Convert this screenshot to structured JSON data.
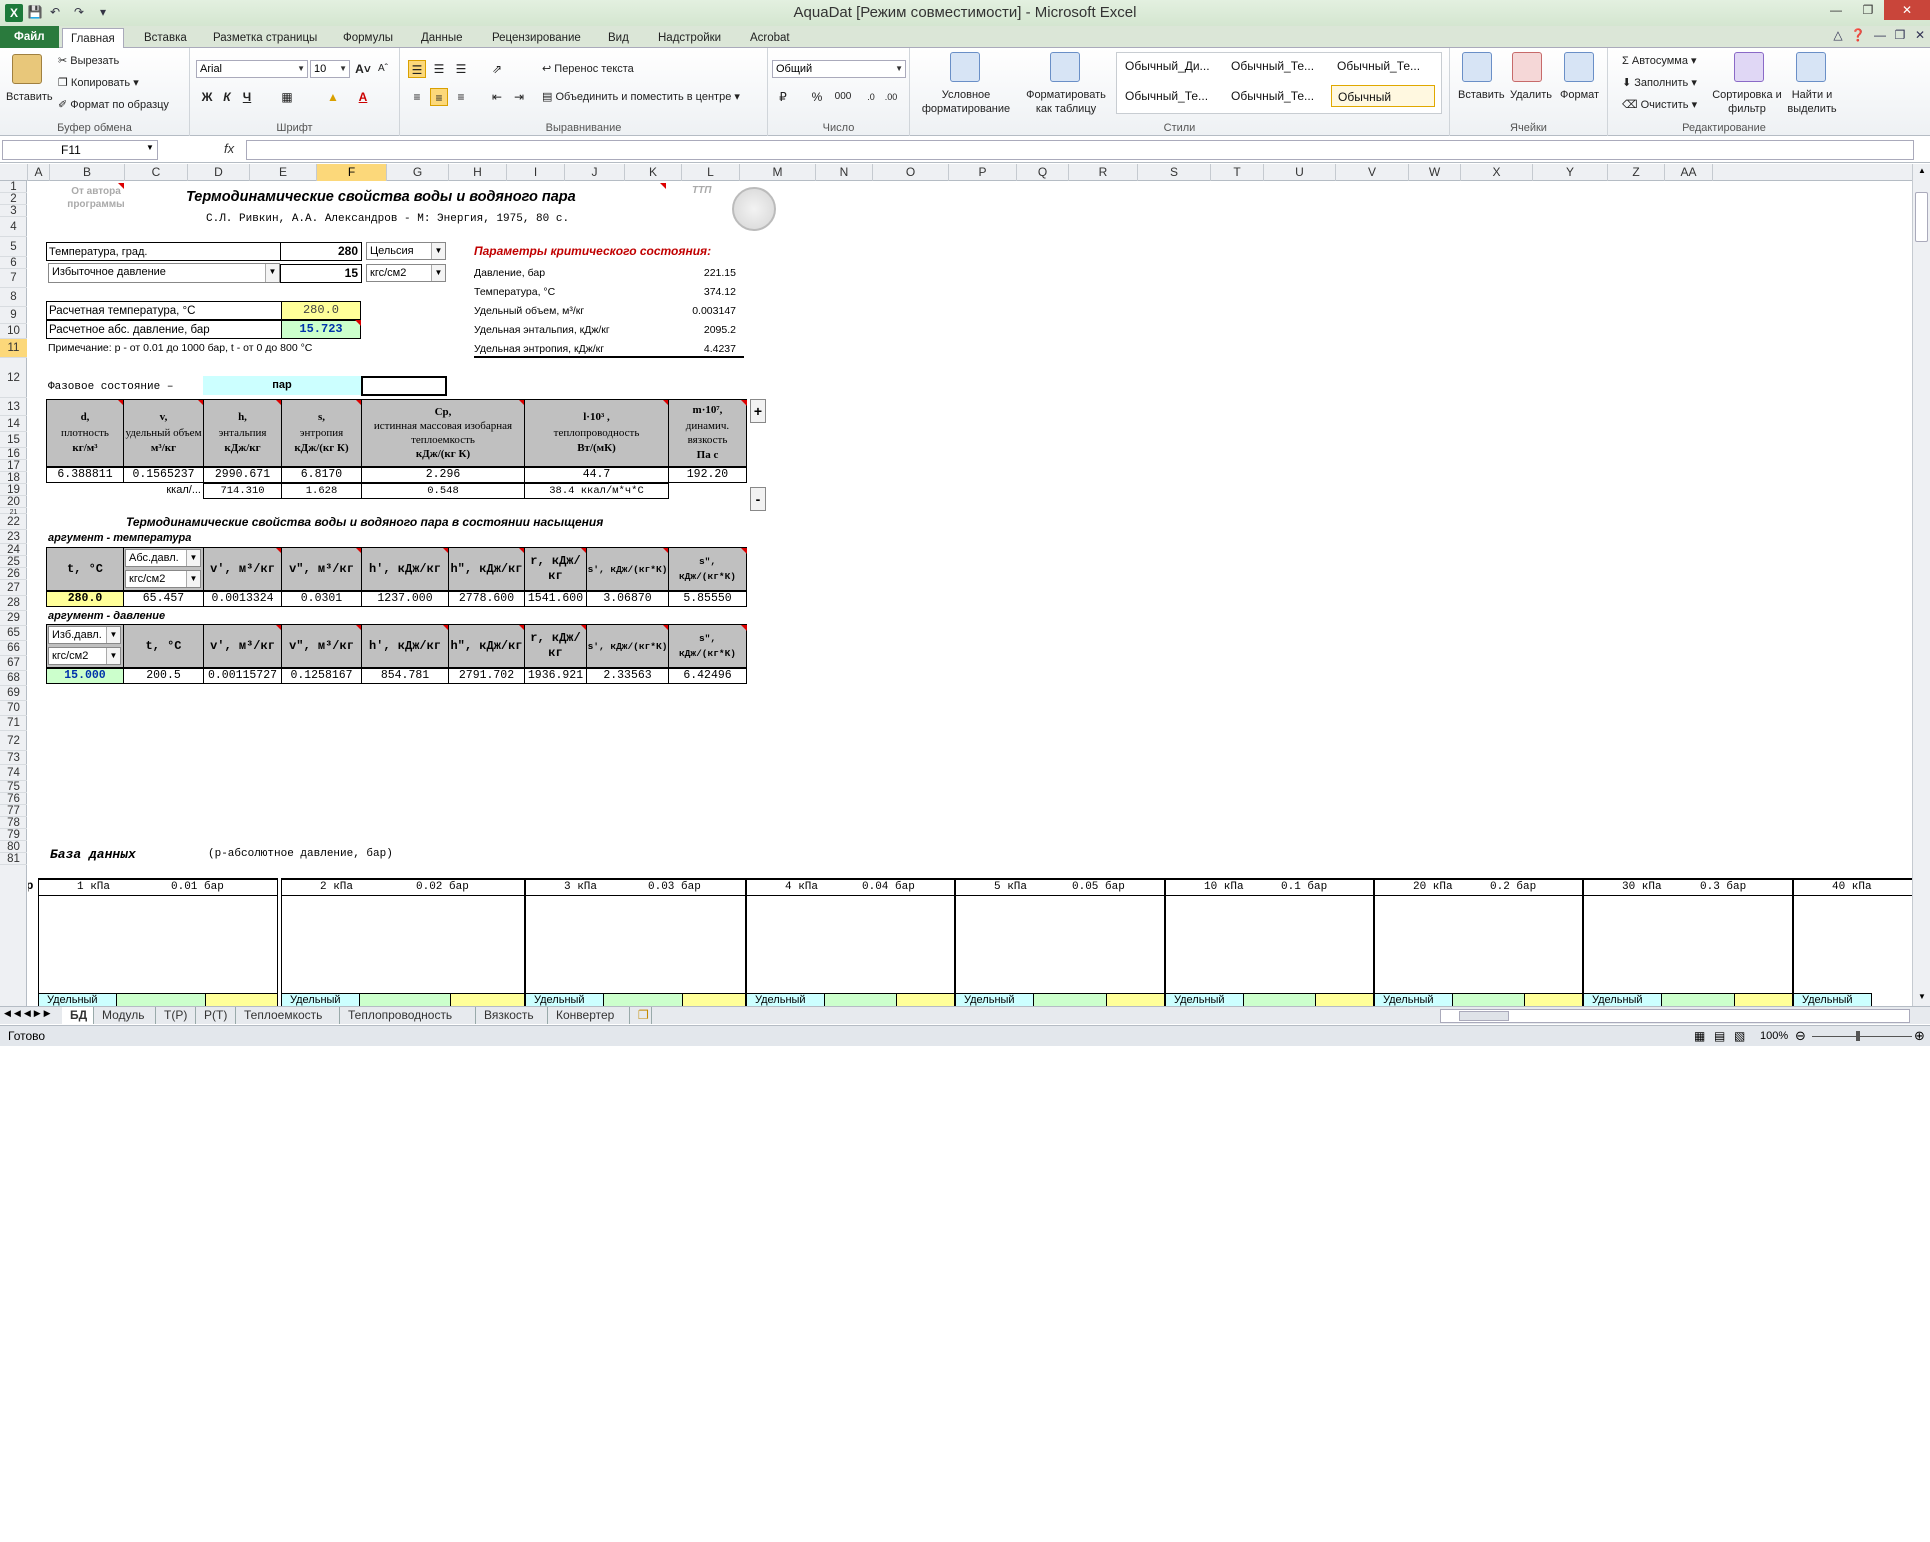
{
  "window": {
    "title": "AquaDat  [Режим совместимости]  -  Microsoft Excel"
  },
  "menu_tabs": [
    "Файл",
    "Главная",
    "Вставка",
    "Разметка страницы",
    "Формулы",
    "Данные",
    "Рецензирование",
    "Вид",
    "Надстройки",
    "Acrobat"
  ],
  "ribbon": {
    "clipboard": {
      "paste": "Вставить",
      "cut": "Вырезать",
      "copy": "Копировать",
      "format_painter": "Формат по образцу",
      "label": "Буфер обмена"
    },
    "font": {
      "name": "Arial",
      "size": "10",
      "label": "Шрифт",
      "bold": "Ж",
      "italic": "К",
      "underline": "Ч"
    },
    "alignment": {
      "wrap": "Перенос текста",
      "merge": "Объединить и поместить в центре",
      "label": "Выравнивание"
    },
    "number": {
      "format": "Общий",
      "percent": "%",
      "thousands": "000",
      "label": "Число"
    },
    "styles": {
      "cond_fmt": "Условное форматирование",
      "fmt_table": "Форматировать как таблицу",
      "cells": [
        "Обычный_Ди...",
        "Обычный_Те...",
        "Обычный_Те...",
        "Обычный_Те...",
        "Обычный_Те...",
        "Обычный"
      ],
      "label": "Стили"
    },
    "cells": {
      "insert": "Вставить",
      "delete": "Удалить",
      "format": "Формат",
      "label": "Ячейки"
    },
    "editing": {
      "autosum": "Автосумма",
      "fill": "Заполнить",
      "clear": "Очистить",
      "sort": "Сортировка и фильтр",
      "find": "Найти и выделить",
      "label": "Редактирование"
    }
  },
  "formula_bar": {
    "name_box": "F11",
    "fx": "fx",
    "formula": ""
  },
  "columns": [
    "A",
    "B",
    "C",
    "D",
    "E",
    "F",
    "G",
    "H",
    "I",
    "J",
    "K",
    "L",
    "M",
    "N",
    "O",
    "P",
    "Q",
    "R",
    "S",
    "T",
    "U",
    "V",
    "W",
    "X",
    "Y",
    "Z",
    "AA"
  ],
  "selected_column": "F",
  "rows": [
    "1",
    "2",
    "3",
    "4",
    "5",
    "6",
    "7",
    "8",
    "9",
    "10",
    "11",
    "12",
    "13",
    "14",
    "15",
    "16",
    "17",
    "18",
    "19",
    "20",
    "21",
    "22",
    "23",
    "24",
    "25",
    "26",
    "27",
    "28",
    "29",
    "65",
    "66",
    "67",
    "68",
    "69",
    "70",
    "71",
    "72",
    "73",
    "74",
    "75",
    "76",
    "77",
    "78",
    "79",
    "80",
    "81"
  ],
  "selected_row": "11",
  "sheet": {
    "author_note": "От автора программы",
    "title": "Термодинамические свойства воды и водяного пара",
    "reference": "С.Л. Ривкин, А.А. Александров - М: Энергия, 1975, 80 с.",
    "ttp": "ТТП",
    "temp_label": "Температура, град.",
    "temp_value": "280",
    "temp_unit": "Цельсия",
    "pressure_mode": "Избыточное давление",
    "pressure_value": "15",
    "pressure_unit": "кгс/см2",
    "calc_temp_label": "Расчетная температура, °С",
    "calc_temp_value": "280.0",
    "calc_pres_label": "Расчетное абс. давление, бар",
    "calc_pres_value": "15.723",
    "note": "Примечание: p - от 0.01 до 1000 бар, t - от 0 до 800 °С",
    "critical": {
      "title": "Параметры критического состояния:",
      "rows": [
        {
          "label": "Давление, бар",
          "value": "221.15"
        },
        {
          "label": "Температура, °С",
          "value": "374.12"
        },
        {
          "label": "Удельный объем, м³/кг",
          "value": "0.003147"
        },
        {
          "label": "Удельная энтальпия, кДж/кг",
          "value": "2095.2"
        },
        {
          "label": "Удельная энтропия, кДж/кг",
          "value": "4.4237"
        }
      ]
    },
    "phase_label": "Фазовое  состояние  –",
    "phase_value": "пар",
    "props_headers": [
      {
        "l1": "d,",
        "l2": "плотность",
        "l3": "кг/м³"
      },
      {
        "l1": "v,",
        "l2": "удельный объем",
        "l3": "м³/кг"
      },
      {
        "l1": "h,",
        "l2": "энтальпия",
        "l3": "кДж/кг"
      },
      {
        "l1": "s,",
        "l2": "энтропия",
        "l3": "кДж/(кг К)"
      },
      {
        "l1": "Cp,",
        "l2": "истинная массовая изобарная теплоемкость",
        "l3": "кДж/(кг К)"
      },
      {
        "l1": "l·10³ ,",
        "l2": "теплопроводность",
        "l3": "Вт/(мК)"
      },
      {
        "l1": "m·10⁷,",
        "l2": "динамич. вязкость",
        "l3": "Па с"
      }
    ],
    "props_values": [
      "6.388811",
      "0.1565237",
      "2990.671",
      "6.8170",
      "2.296",
      "44.7",
      "192.20"
    ],
    "kcal_label": "ккал/...",
    "kcal_values": [
      "714.310",
      "1.628",
      "0.548",
      "38.4 ккал/м*ч*С"
    ],
    "plus": "+",
    "minus": "-",
    "sat_title": "Термодинамические свойства воды и водяного пара в состоянии насыщения",
    "arg_temp": "аргумент - температура",
    "sat_t_headers": [
      "t, °C",
      "",
      "v',  м³/кг",
      "v\",  м³/кг",
      "h',  кДж/кг",
      "h\",  кДж/кг",
      "r,  кДж/кг",
      "s',  кДж/(кг*К)",
      "s\",  кДж/(кг*К)"
    ],
    "sat_t_dd1": "Абс.давл.",
    "sat_t_dd2": "кгс/см2",
    "sat_t_values": [
      "280.0",
      "65.457",
      "0.0013324",
      "0.0301",
      "1237.000",
      "2778.600",
      "1541.600",
      "3.06870",
      "5.85550"
    ],
    "arg_pres": "аргумент - давление",
    "sat_p_dd1": "Изб.давл.",
    "sat_p_dd2": "кгс/см2",
    "sat_p_headers": [
      "",
      "t, °C",
      "v',  м³/кг",
      "v\",  м³/кг",
      "h',  кДж/кг",
      "h\",  кДж/кг",
      "r,  кДж/кг",
      "s',  кДж/(кг*К)",
      "s\",  кДж/(кг*К)"
    ],
    "sat_p_values": [
      "15.000",
      "200.5",
      "0.00115727",
      "0.1258167",
      "854.781",
      "2791.702",
      "1936.921",
      "2.33563",
      "6.42496"
    ],
    "db_title": "База данных",
    "db_subtitle": "(p-абсолютное давление, бар)",
    "db_p": "p",
    "db_blocks": [
      {
        "kpa": "1 кПа",
        "bar": "0.01 бар"
      },
      {
        "kpa": "2 кПа",
        "bar": "0.02 бар"
      },
      {
        "kpa": "3 кПа",
        "bar": "0.03 бар"
      },
      {
        "kpa": "4 кПа",
        "bar": "0.04 бар"
      },
      {
        "kpa": "5 кПа",
        "bar": "0.05 бар"
      },
      {
        "kpa": "10 кПа",
        "bar": "0.1 бар"
      },
      {
        "kpa": "20 кПа",
        "bar": "0.2 бар"
      },
      {
        "kpa": "30 кПа",
        "bar": "0.3 бар"
      },
      {
        "kpa": "40 кПа",
        "bar": ""
      }
    ],
    "db_row81": "Удельный"
  },
  "sheet_tabs": [
    "БД",
    "Модуль",
    "Т(P)",
    "P(T)",
    "Теплоемкость",
    "Теплопроводность",
    "Вязкость",
    "Конвертер"
  ],
  "status": {
    "ready": "Готово",
    "zoom": "100%"
  }
}
